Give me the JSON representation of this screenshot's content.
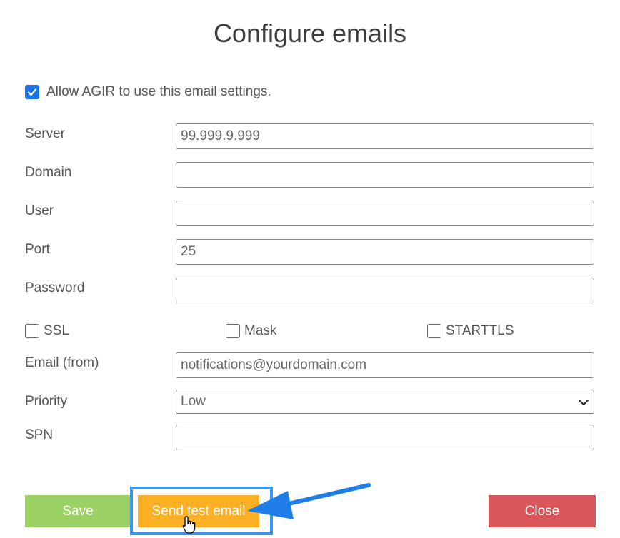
{
  "dialog": {
    "title": "Configure emails",
    "allow_label": "Allow AGIR to use this email settings.",
    "allow_checked": true
  },
  "fields": {
    "server": {
      "label": "Server",
      "value": "99.999.9.999"
    },
    "domain": {
      "label": "Domain",
      "value": ""
    },
    "user": {
      "label": "User",
      "value": ""
    },
    "port": {
      "label": "Port",
      "value": "25"
    },
    "password": {
      "label": "Password",
      "value": ""
    },
    "email_from": {
      "label": "Email (from)",
      "value": "notifications@yourdomain.com"
    },
    "priority": {
      "label": "Priority",
      "value": "Low"
    },
    "spn": {
      "label": "SPN",
      "value": ""
    }
  },
  "options": {
    "ssl": {
      "label": "SSL",
      "checked": false
    },
    "mask": {
      "label": "Mask",
      "checked": false
    },
    "starttls": {
      "label": "STARTTLS",
      "checked": false
    }
  },
  "buttons": {
    "save": "Save",
    "send_test": "Send test email",
    "close": "Close"
  },
  "colors": {
    "save": "#9cd163",
    "send_test": "#fbb025",
    "close": "#d9575a",
    "highlight": "#3b93f2",
    "checkbox": "#1a73e8"
  }
}
